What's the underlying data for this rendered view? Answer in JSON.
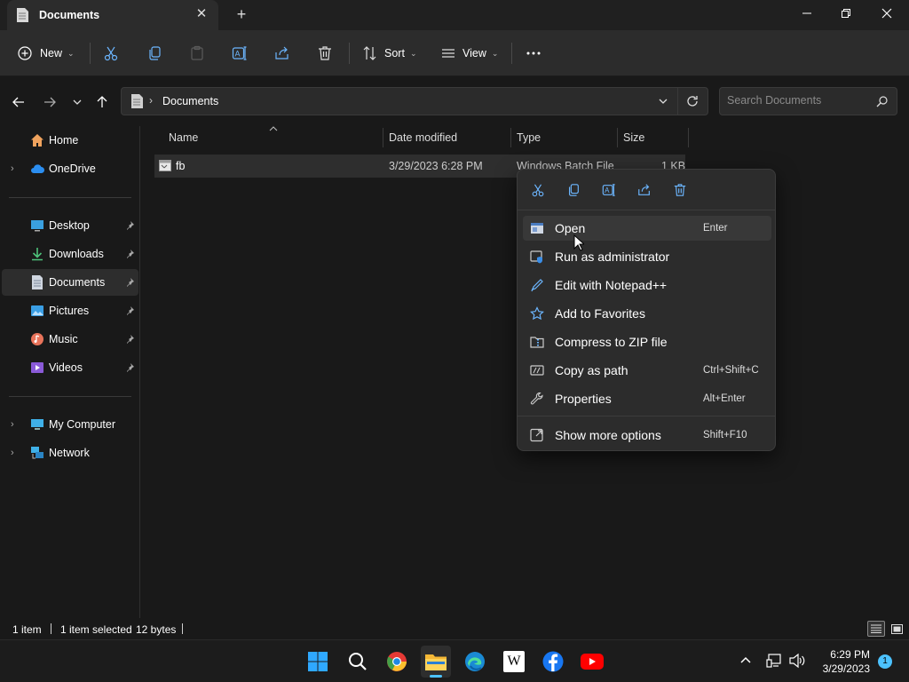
{
  "window": {
    "tab_title": "Documents",
    "icons": [
      "document-icon",
      "close-icon",
      "plus-icon",
      "minimize-icon",
      "maximize-icon",
      "close-window-icon"
    ]
  },
  "command_bar": {
    "new_label": "New",
    "sort_label": "Sort",
    "view_label": "View",
    "icons": [
      "plus-circle-icon",
      "cut-icon",
      "copy-icon",
      "paste-icon",
      "rename-icon",
      "share-icon",
      "delete-icon",
      "sort-icon",
      "view-icon",
      "more-icon"
    ]
  },
  "address": {
    "path": "Documents",
    "search_placeholder": "Search Documents"
  },
  "sidebar": {
    "items": [
      {
        "label": "Home",
        "icon": "home-icon"
      },
      {
        "label": "OneDrive",
        "icon": "cloud-icon"
      },
      {
        "label": "Desktop",
        "icon": "desktop-icon",
        "pinned": true
      },
      {
        "label": "Downloads",
        "icon": "download-icon",
        "pinned": true
      },
      {
        "label": "Documents",
        "icon": "document-icon",
        "pinned": true,
        "selected": true
      },
      {
        "label": "Pictures",
        "icon": "picture-icon",
        "pinned": true
      },
      {
        "label": "Music",
        "icon": "music-icon",
        "pinned": true
      },
      {
        "label": "Videos",
        "icon": "video-icon",
        "pinned": true
      },
      {
        "label": "My Computer",
        "icon": "computer-icon"
      },
      {
        "label": "Network",
        "icon": "network-icon"
      }
    ]
  },
  "files": {
    "columns": [
      "Name",
      "Date modified",
      "Type",
      "Size"
    ],
    "rows": [
      {
        "name": "fb",
        "date": "3/29/2023 6:28 PM",
        "type": "Windows Batch File",
        "size": "1 KB"
      }
    ]
  },
  "context_menu": {
    "quick_actions": [
      "cut-icon",
      "copy-icon",
      "rename-icon",
      "share-icon",
      "delete-icon"
    ],
    "items": [
      {
        "label": "Open",
        "shortcut": "Enter",
        "icon": "open-window-icon"
      },
      {
        "label": "Run as administrator",
        "shortcut": "",
        "icon": "shield-window-icon"
      },
      {
        "label": "Edit with Notepad++",
        "shortcut": "",
        "icon": "notepadpp-icon"
      },
      {
        "label": "Add to Favorites",
        "shortcut": "",
        "icon": "star-icon"
      },
      {
        "label": "Compress to ZIP file",
        "shortcut": "",
        "icon": "zip-folder-icon"
      },
      {
        "label": "Copy as path",
        "shortcut": "Ctrl+Shift+C",
        "icon": "copy-path-icon"
      },
      {
        "label": "Properties",
        "shortcut": "Alt+Enter",
        "icon": "wrench-icon"
      },
      {
        "label": "Show more options",
        "shortcut": "Shift+F10",
        "icon": "show-more-icon"
      }
    ]
  },
  "status": {
    "count": "1 item",
    "selection": "1 item selected",
    "size": "12 bytes"
  },
  "taskbar": {
    "apps": [
      "windows-start-icon",
      "search-icon",
      "chrome-icon",
      "file-explorer-icon",
      "edge-icon",
      "wikipedia-icon",
      "facebook-icon",
      "youtube-icon"
    ],
    "time": "6:29 PM",
    "date": "3/29/2023",
    "notification_count": "1"
  },
  "colors": {
    "background": "#191919",
    "toolbar": "#2c2c2c",
    "accent": "#4cc2ff",
    "youtube": "#ff0000",
    "facebook": "#1877f2"
  }
}
